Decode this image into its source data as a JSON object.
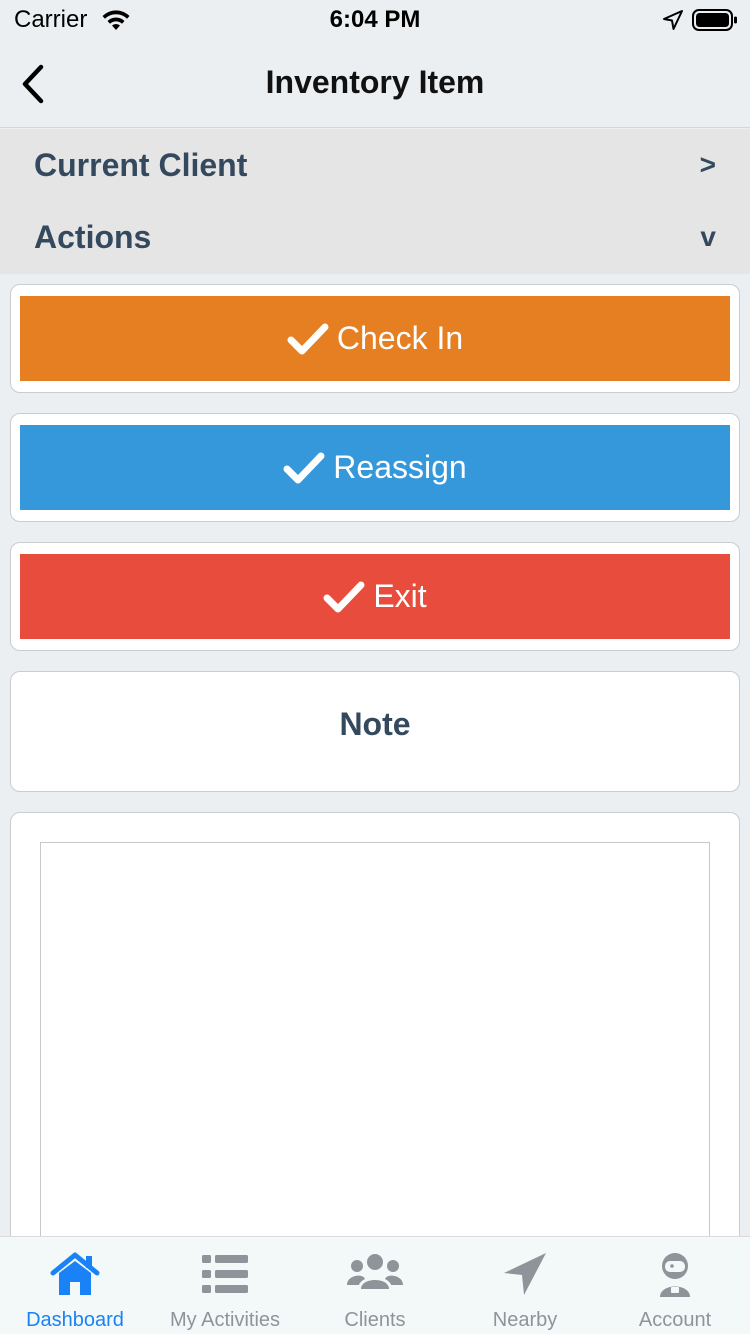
{
  "status_bar": {
    "carrier": "Carrier",
    "time": "6:04 PM"
  },
  "nav": {
    "title": "Inventory Item",
    "back_icon": "chevron-left-icon"
  },
  "accordion": {
    "current_client": {
      "label": "Current Client",
      "indicator": ">"
    },
    "actions": {
      "label": "Actions",
      "indicator": "v"
    }
  },
  "actions": {
    "check_in": {
      "label": "Check In",
      "color": "#e67e22",
      "icon": "checkmark-icon"
    },
    "reassign": {
      "label": "Reassign",
      "color": "#3498db",
      "icon": "checkmark-icon"
    },
    "exit": {
      "label": "Exit",
      "color": "#e74c3c",
      "icon": "checkmark-icon"
    }
  },
  "note": {
    "title": "Note",
    "value": ""
  },
  "tabs": [
    {
      "label": "Dashboard",
      "icon": "home-icon",
      "active": true
    },
    {
      "label": "My Activities",
      "icon": "list-icon",
      "active": false
    },
    {
      "label": "Clients",
      "icon": "users-icon",
      "active": false
    },
    {
      "label": "Nearby",
      "icon": "location-arrow-icon",
      "active": false
    },
    {
      "label": "Account",
      "icon": "astronaut-icon",
      "active": false
    }
  ],
  "colors": {
    "accent": "#1a82f7",
    "inactive_tab": "#8e9499",
    "heading": "#34495e"
  }
}
